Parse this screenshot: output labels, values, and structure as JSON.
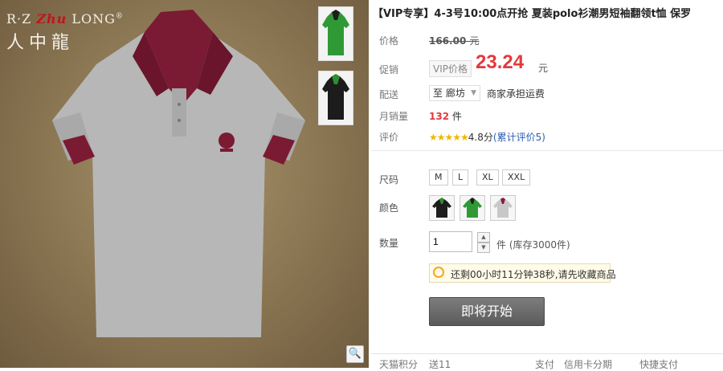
{
  "brand": {
    "logo_top": "R·Z",
    "logo_swirl": "Zhu",
    "logo_long": "LONG",
    "logo_reg": "®",
    "logo_cn": "人中龍"
  },
  "product": {
    "title": "【VIP专享】4-3号10:00点开抢 夏装polo衫潮男短袖翻领t恤 保罗",
    "labels": {
      "price": "价格",
      "promo": "促销",
      "delivery": "配送",
      "monthly": "月销量",
      "rating": "评价",
      "size": "尺码",
      "color": "颜色",
      "qty": "数量"
    },
    "orig_price": "166.00",
    "yuan": "元",
    "vip_tag": "VIP价格",
    "price": "23.24",
    "dest": "至 廊坊",
    "shipping": "商家承担运费",
    "sold_count": "132",
    "sold_unit": "件",
    "stars": "★★★★★",
    "score": "4.8分",
    "reviews_link": "(累计评价5)"
  },
  "options": {
    "sizes": [
      "M",
      "L",
      "XL",
      "XXL"
    ],
    "swatches": [
      {
        "name": "black",
        "shirt": "#1c1c1c",
        "collar": "#2f8d2f"
      },
      {
        "name": "green",
        "shirt": "#2f9a35",
        "collar": "#1d1d1d"
      },
      {
        "name": "gray",
        "shirt": "#c8c8c8",
        "collar": "#8a1d3a"
      }
    ],
    "qty_value": "1",
    "stock": "件 (库存3000件)",
    "tip": "还剩00小时11分钟38秒,请先收藏商品",
    "buy_button": "即将开始"
  },
  "bottom": {
    "points_label": "天猫积分",
    "points_value": "送11",
    "pay_label": "支付",
    "credit": "信用卡分期",
    "quick_pay": "快捷支付"
  },
  "colors": {
    "accent": "#e4393c",
    "shirt_gray": "#b5b5b5",
    "collar": "#7b1a33"
  }
}
